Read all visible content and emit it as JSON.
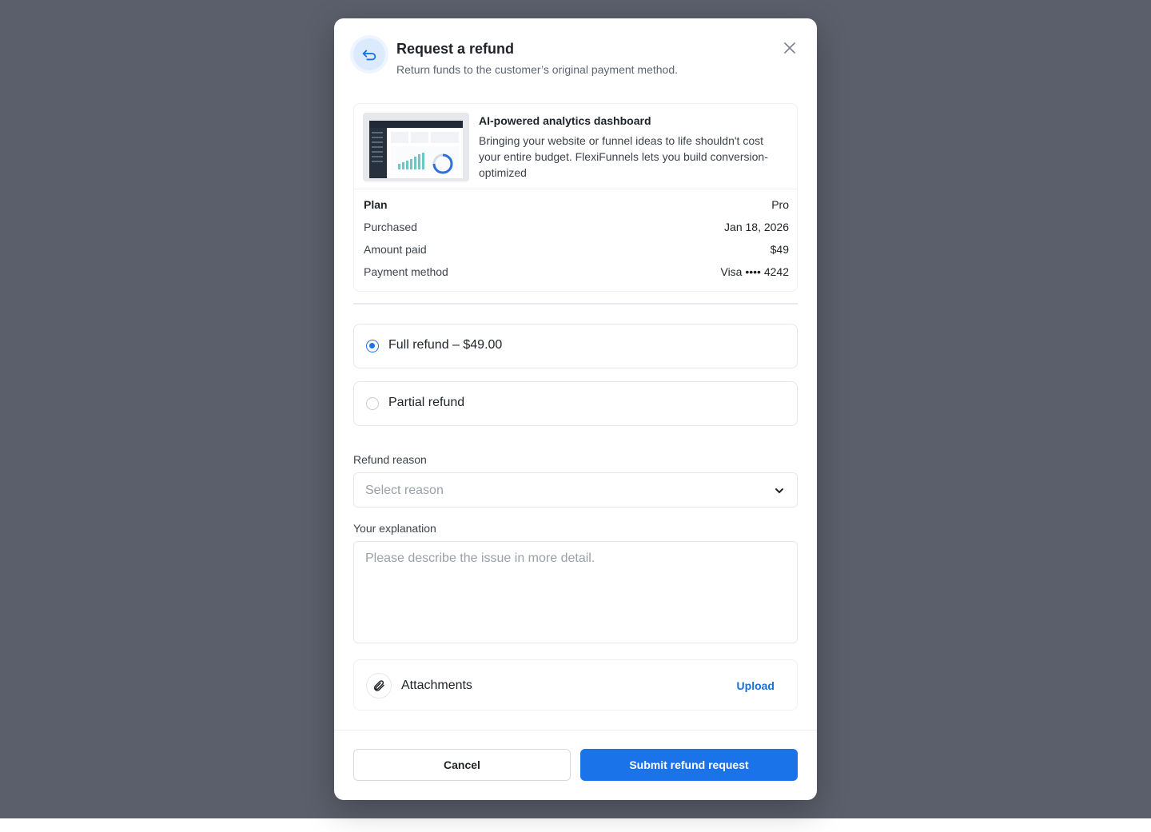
{
  "dialog": {
    "title": "Request a refund",
    "subtitle": "Return funds to the customer’s original payment method.",
    "icon": "refund-return-icon",
    "close_icon": "close-icon"
  },
  "product": {
    "name": "AI-powered analytics dashboard",
    "description": "Bringing your website or funnel ideas to life shouldn't cost your entire budget. FlexiFunnels lets you build conversion-optimized",
    "thumbnail": "dashboard-screenshot-thumbnail"
  },
  "details": [
    {
      "label": "Plan",
      "value": "Pro"
    },
    {
      "label": "Purchased",
      "value": "Jan 18, 2026"
    },
    {
      "label": "Amount paid",
      "value": "$49"
    },
    {
      "label": "Payment method",
      "value": "Visa •••• 4242"
    }
  ],
  "refund_options": [
    {
      "label": "Full refund – $49.00",
      "selected": true
    },
    {
      "label": "Partial refund",
      "selected": false
    }
  ],
  "reason": {
    "label": "Refund reason",
    "placeholder": "Select reason"
  },
  "explanation": {
    "label": "Your explanation",
    "placeholder": "Please describe the issue in more detail."
  },
  "attachments": {
    "label": "Attachments",
    "action": "Upload",
    "icon": "paperclip-icon"
  },
  "footer": {
    "cancel_label": "Cancel",
    "submit_label": "Submit refund request"
  },
  "colors": {
    "accent": "#1a73e8",
    "backdrop": "#5b5f6b",
    "link": "#1a6fd6"
  }
}
